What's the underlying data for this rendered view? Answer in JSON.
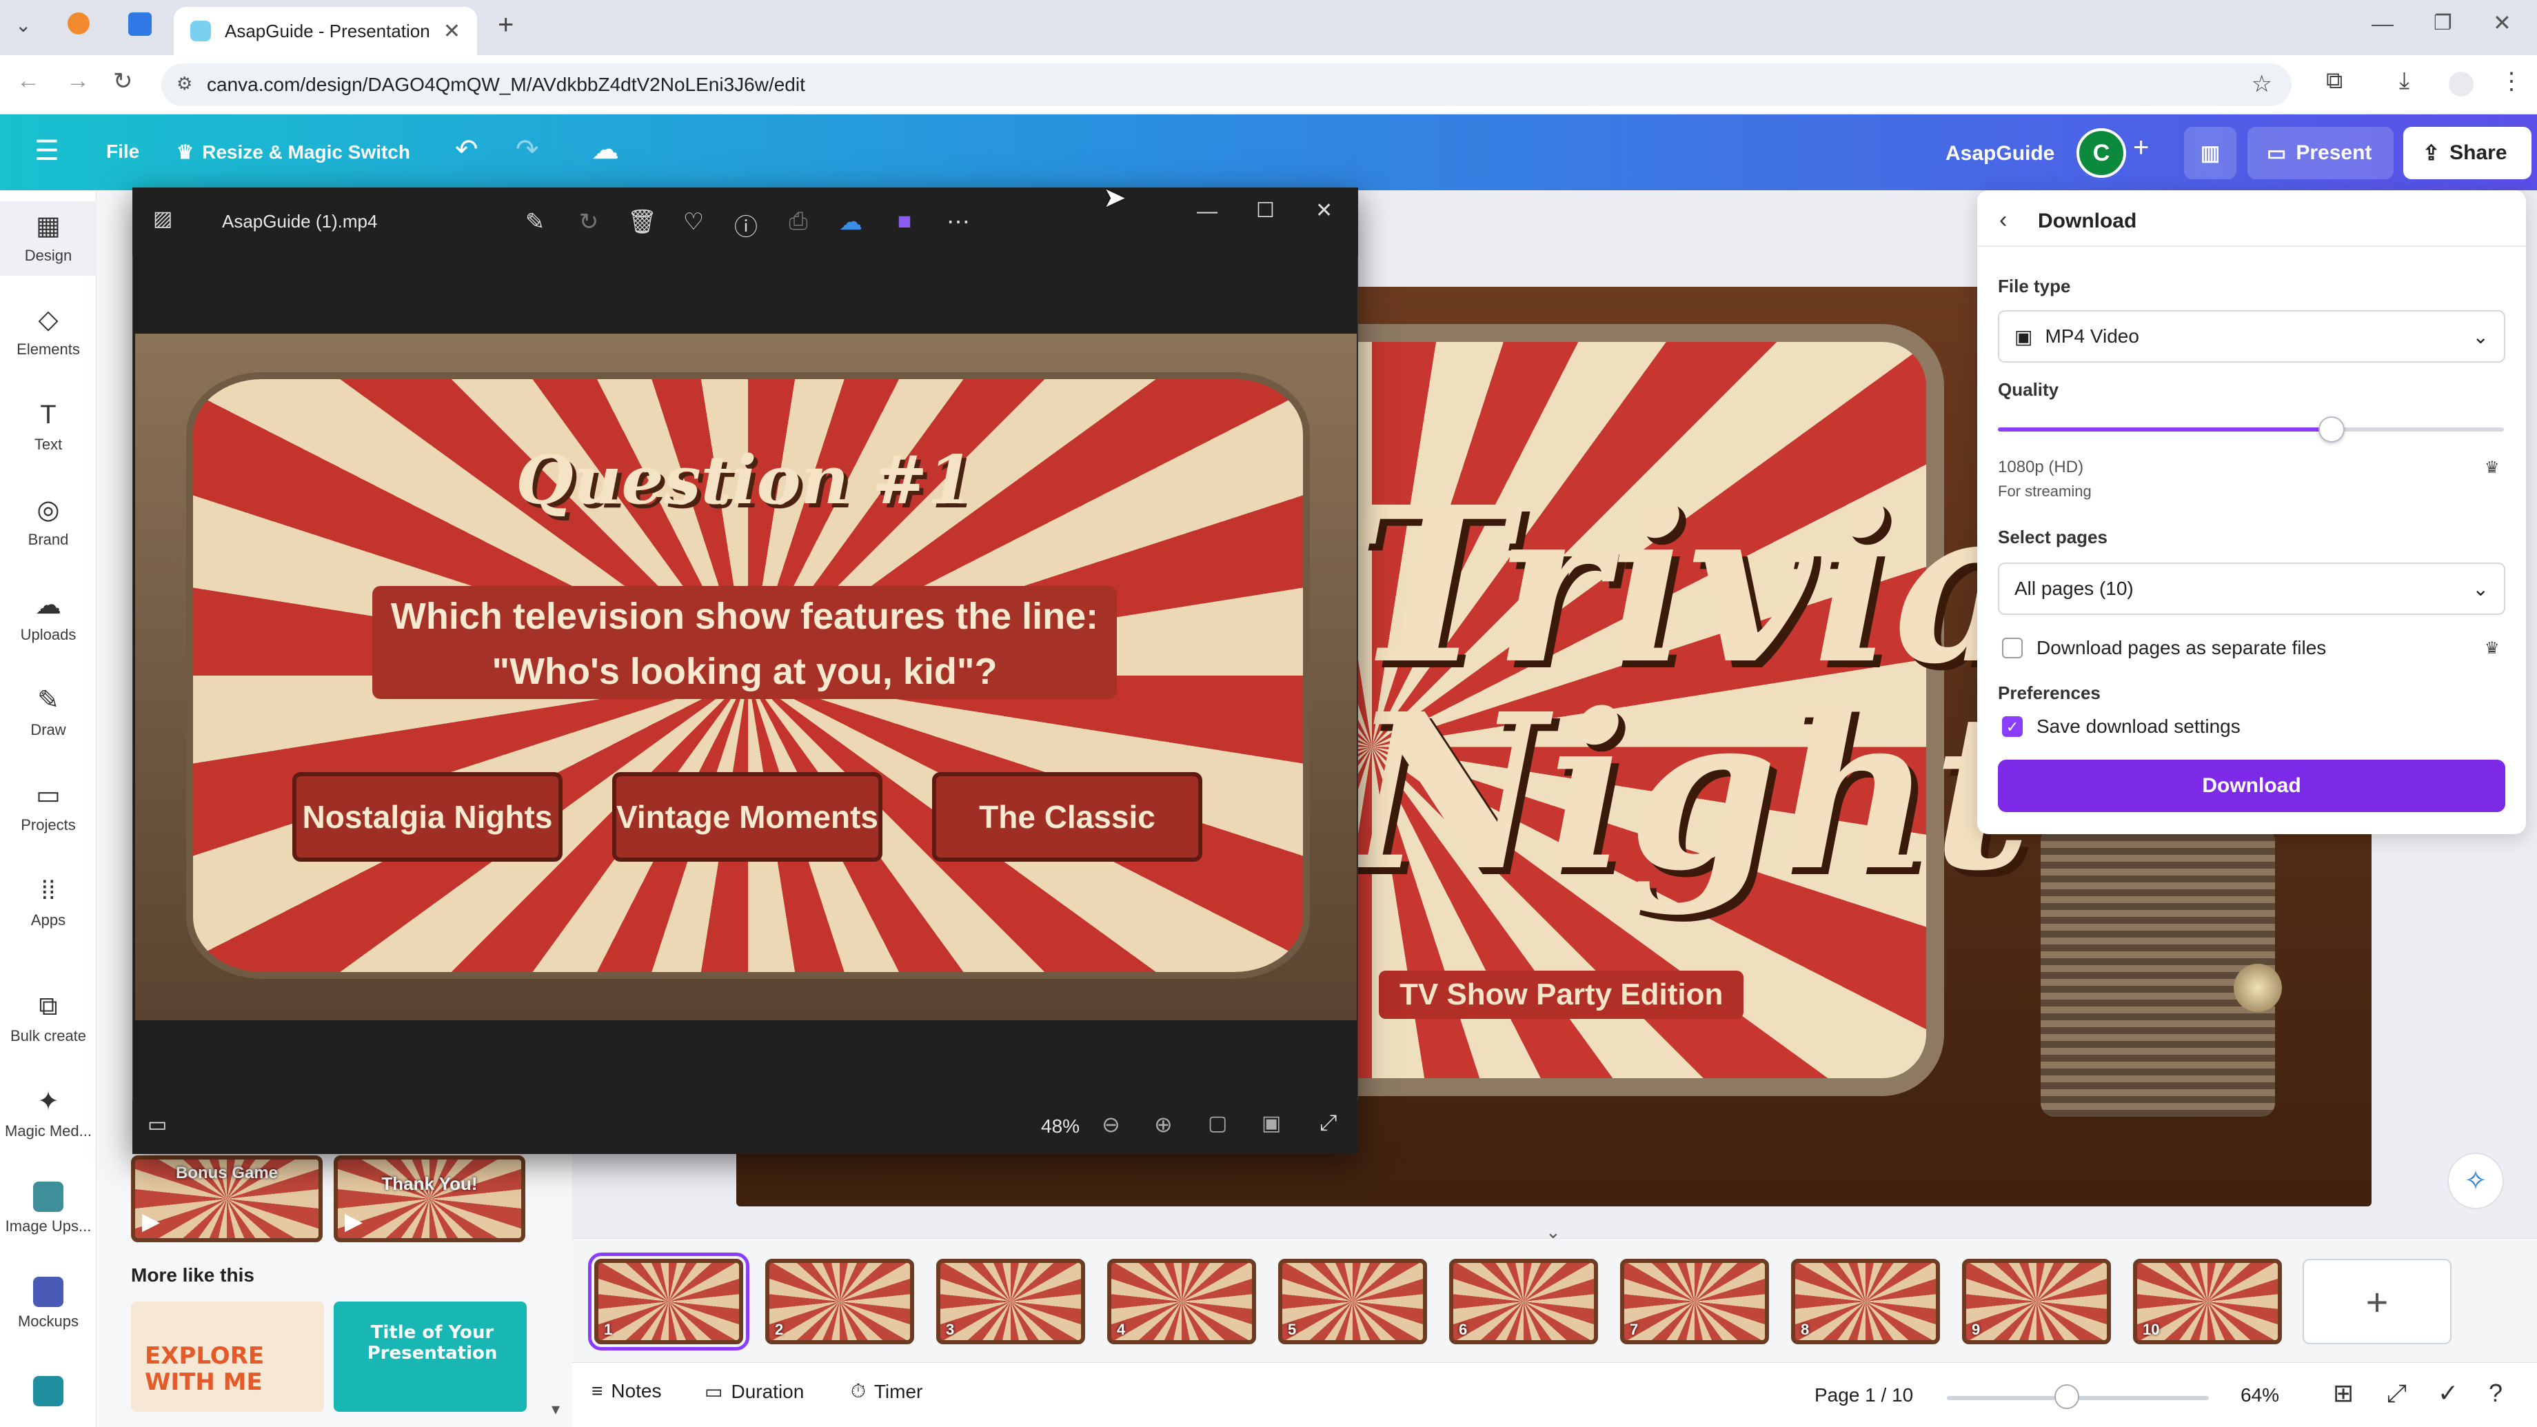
{
  "browser": {
    "tab_title": "AsapGuide - Presentation",
    "url": "canva.com/design/DAGO4QmQW_M/AVdkbbZ4dtV2NoLEni3J6w/edit"
  },
  "header": {
    "file_label": "File",
    "resize_label": "Resize & Magic Switch",
    "project_name": "AsapGuide",
    "avatar_letter": "C",
    "present_label": "Present",
    "share_label": "Share"
  },
  "rail": {
    "items": [
      {
        "label": "Design",
        "icon": "design-icon"
      },
      {
        "label": "Elements",
        "icon": "elements-icon"
      },
      {
        "label": "Text",
        "icon": "text-icon"
      },
      {
        "label": "Brand",
        "icon": "brand-icon"
      },
      {
        "label": "Uploads",
        "icon": "uploads-icon"
      },
      {
        "label": "Draw",
        "icon": "draw-icon"
      },
      {
        "label": "Projects",
        "icon": "projects-icon"
      },
      {
        "label": "Apps",
        "icon": "apps-icon"
      },
      {
        "label": "Bulk create",
        "icon": "bulk-create-icon"
      },
      {
        "label": "Magic Med...",
        "icon": "magic-media-icon"
      },
      {
        "label": "Image Ups...",
        "icon": "image-upscaler-icon"
      },
      {
        "label": "Mockups",
        "icon": "mockups-icon"
      }
    ]
  },
  "side_panel": {
    "thumb_1_text": "Bonus Game",
    "thumb_2_text": "Thank You!",
    "more_like_this": "More like this",
    "card_1_text": "EXPLORE WITH ME",
    "card_2_text": "Title of Your Presentation"
  },
  "photo_viewer": {
    "file_name": "AsapGuide (1).mp4",
    "question_title": "Question #1",
    "question_line_1": "Which television show features the line:",
    "question_line_2": "\"Who's looking at you, kid\"?",
    "answers": [
      "Nostalgia Nights",
      "Vintage Moments",
      "The Classic"
    ],
    "zoom": "48%"
  },
  "slide": {
    "title_line_1": "Trivia",
    "title_line_2": "Night",
    "subtitle": "TV Show Party Edition"
  },
  "download_panel": {
    "title": "Download",
    "file_type_label": "File type",
    "file_type_value": "MP4 Video",
    "quality_label": "Quality",
    "quality_fraction": 0.66,
    "quality_value": "1080p (HD)",
    "quality_note": "For streaming",
    "select_pages_label": "Select pages",
    "select_pages_value": "All pages (10)",
    "separate_files_label": "Download pages as separate files",
    "separate_files_checked": false,
    "preferences_label": "Preferences",
    "save_settings_label": "Save download settings",
    "save_settings_checked": true,
    "download_button": "Download"
  },
  "filmstrip": {
    "pages": [
      "1",
      "2",
      "3",
      "4",
      "5",
      "6",
      "7",
      "8",
      "9",
      "10"
    ]
  },
  "bottom_bar": {
    "notes": "Notes",
    "duration": "Duration",
    "timer": "Timer",
    "page_indicator": "Page 1 / 10",
    "zoom": "64%"
  },
  "colors": {
    "accent": "#8b3dff",
    "download_button": "#7d2ae8",
    "header_start": "#18c1cf",
    "header_end": "#5a4fe8"
  }
}
